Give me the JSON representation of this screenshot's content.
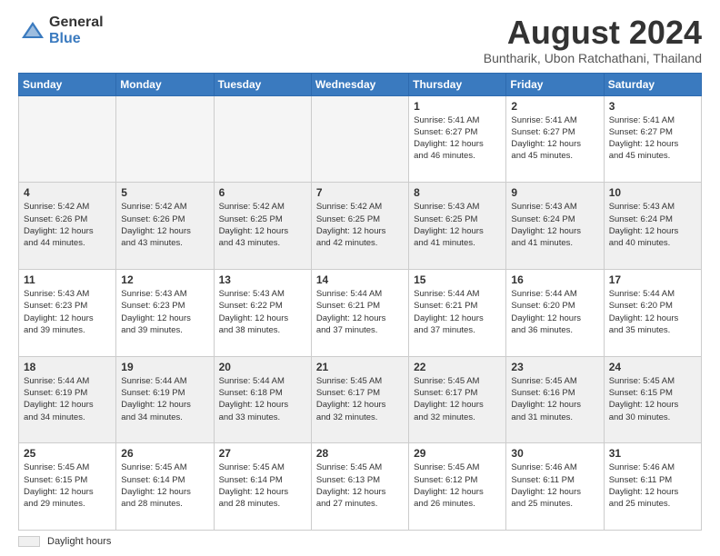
{
  "logo": {
    "general": "General",
    "blue": "Blue"
  },
  "header": {
    "month_year": "August 2024",
    "location": "Buntharik, Ubon Ratchathani, Thailand"
  },
  "days_of_week": [
    "Sunday",
    "Monday",
    "Tuesday",
    "Wednesday",
    "Thursday",
    "Friday",
    "Saturday"
  ],
  "legend": {
    "label": "Daylight hours"
  },
  "weeks": [
    {
      "days": [
        {
          "num": "",
          "info": "",
          "empty": true
        },
        {
          "num": "",
          "info": "",
          "empty": true
        },
        {
          "num": "",
          "info": "",
          "empty": true
        },
        {
          "num": "",
          "info": "",
          "empty": true
        },
        {
          "num": "1",
          "info": "Sunrise: 5:41 AM\nSunset: 6:27 PM\nDaylight: 12 hours\nand 46 minutes."
        },
        {
          "num": "2",
          "info": "Sunrise: 5:41 AM\nSunset: 6:27 PM\nDaylight: 12 hours\nand 45 minutes."
        },
        {
          "num": "3",
          "info": "Sunrise: 5:41 AM\nSunset: 6:27 PM\nDaylight: 12 hours\nand 45 minutes."
        }
      ]
    },
    {
      "days": [
        {
          "num": "4",
          "info": "Sunrise: 5:42 AM\nSunset: 6:26 PM\nDaylight: 12 hours\nand 44 minutes."
        },
        {
          "num": "5",
          "info": "Sunrise: 5:42 AM\nSunset: 6:26 PM\nDaylight: 12 hours\nand 43 minutes."
        },
        {
          "num": "6",
          "info": "Sunrise: 5:42 AM\nSunset: 6:25 PM\nDaylight: 12 hours\nand 43 minutes."
        },
        {
          "num": "7",
          "info": "Sunrise: 5:42 AM\nSunset: 6:25 PM\nDaylight: 12 hours\nand 42 minutes."
        },
        {
          "num": "8",
          "info": "Sunrise: 5:43 AM\nSunset: 6:25 PM\nDaylight: 12 hours\nand 41 minutes."
        },
        {
          "num": "9",
          "info": "Sunrise: 5:43 AM\nSunset: 6:24 PM\nDaylight: 12 hours\nand 41 minutes."
        },
        {
          "num": "10",
          "info": "Sunrise: 5:43 AM\nSunset: 6:24 PM\nDaylight: 12 hours\nand 40 minutes."
        }
      ]
    },
    {
      "days": [
        {
          "num": "11",
          "info": "Sunrise: 5:43 AM\nSunset: 6:23 PM\nDaylight: 12 hours\nand 39 minutes."
        },
        {
          "num": "12",
          "info": "Sunrise: 5:43 AM\nSunset: 6:23 PM\nDaylight: 12 hours\nand 39 minutes."
        },
        {
          "num": "13",
          "info": "Sunrise: 5:43 AM\nSunset: 6:22 PM\nDaylight: 12 hours\nand 38 minutes."
        },
        {
          "num": "14",
          "info": "Sunrise: 5:44 AM\nSunset: 6:21 PM\nDaylight: 12 hours\nand 37 minutes."
        },
        {
          "num": "15",
          "info": "Sunrise: 5:44 AM\nSunset: 6:21 PM\nDaylight: 12 hours\nand 37 minutes."
        },
        {
          "num": "16",
          "info": "Sunrise: 5:44 AM\nSunset: 6:20 PM\nDaylight: 12 hours\nand 36 minutes."
        },
        {
          "num": "17",
          "info": "Sunrise: 5:44 AM\nSunset: 6:20 PM\nDaylight: 12 hours\nand 35 minutes."
        }
      ]
    },
    {
      "days": [
        {
          "num": "18",
          "info": "Sunrise: 5:44 AM\nSunset: 6:19 PM\nDaylight: 12 hours\nand 34 minutes."
        },
        {
          "num": "19",
          "info": "Sunrise: 5:44 AM\nSunset: 6:19 PM\nDaylight: 12 hours\nand 34 minutes."
        },
        {
          "num": "20",
          "info": "Sunrise: 5:44 AM\nSunset: 6:18 PM\nDaylight: 12 hours\nand 33 minutes."
        },
        {
          "num": "21",
          "info": "Sunrise: 5:45 AM\nSunset: 6:17 PM\nDaylight: 12 hours\nand 32 minutes."
        },
        {
          "num": "22",
          "info": "Sunrise: 5:45 AM\nSunset: 6:17 PM\nDaylight: 12 hours\nand 32 minutes."
        },
        {
          "num": "23",
          "info": "Sunrise: 5:45 AM\nSunset: 6:16 PM\nDaylight: 12 hours\nand 31 minutes."
        },
        {
          "num": "24",
          "info": "Sunrise: 5:45 AM\nSunset: 6:15 PM\nDaylight: 12 hours\nand 30 minutes."
        }
      ]
    },
    {
      "days": [
        {
          "num": "25",
          "info": "Sunrise: 5:45 AM\nSunset: 6:15 PM\nDaylight: 12 hours\nand 29 minutes."
        },
        {
          "num": "26",
          "info": "Sunrise: 5:45 AM\nSunset: 6:14 PM\nDaylight: 12 hours\nand 28 minutes."
        },
        {
          "num": "27",
          "info": "Sunrise: 5:45 AM\nSunset: 6:14 PM\nDaylight: 12 hours\nand 28 minutes."
        },
        {
          "num": "28",
          "info": "Sunrise: 5:45 AM\nSunset: 6:13 PM\nDaylight: 12 hours\nand 27 minutes."
        },
        {
          "num": "29",
          "info": "Sunrise: 5:45 AM\nSunset: 6:12 PM\nDaylight: 12 hours\nand 26 minutes."
        },
        {
          "num": "30",
          "info": "Sunrise: 5:46 AM\nSunset: 6:11 PM\nDaylight: 12 hours\nand 25 minutes."
        },
        {
          "num": "31",
          "info": "Sunrise: 5:46 AM\nSunset: 6:11 PM\nDaylight: 12 hours\nand 25 minutes."
        }
      ]
    }
  ]
}
